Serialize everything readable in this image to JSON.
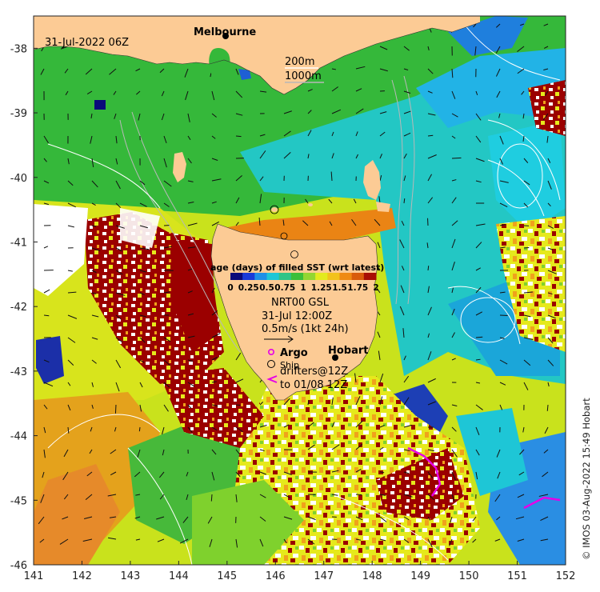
{
  "title": "31-Jul-2022 06Z",
  "credit": "© IMOS 03-Aug-2022 15:49 Hobart",
  "axes": {
    "x_ticks": [
      "141",
      "142",
      "143",
      "144",
      "145",
      "146",
      "147",
      "148",
      "149",
      "150",
      "151",
      "152"
    ],
    "y_ticks": [
      "-38",
      "-39",
      "-40",
      "-41",
      "-42",
      "-43",
      "-44",
      "-45",
      "-46"
    ],
    "lon_range": [
      141,
      152
    ],
    "lat_range": [
      -46,
      -37.5
    ]
  },
  "places": {
    "melbourne": "Melbourne",
    "hobart": "Hobart"
  },
  "isobaths": {
    "shallow": "200m",
    "deep": "1000m"
  },
  "colorbar": {
    "title": "age (days) of filled SST (wrt latest)",
    "labels": [
      "0",
      "0.25",
      "0.5",
      "0.75",
      "1",
      "1.25",
      "1.5",
      "1.75",
      "2"
    ],
    "colors": [
      "#0a0a7a",
      "#1a3ad8",
      "#1f8fe6",
      "#1ec6d6",
      "#2fc487",
      "#3cbf3a",
      "#93d632",
      "#e3ea1e",
      "#f2c21b",
      "#ef8a12",
      "#d95b0a",
      "#a80d05"
    ]
  },
  "current_legend": {
    "product": "NRT00 GSL",
    "time": "31-Jul 12:00Z",
    "scale": "0.5m/s (1kt 24h)"
  },
  "obs_legend": {
    "argo": "Argo",
    "ship": "Ship",
    "drifters": "drifters@12Z",
    "drifters_to": "to 01/08 12Z"
  },
  "land_color": "#fccb95",
  "argo_color": "#e600e6",
  "drifter_color": "#e600e6"
}
